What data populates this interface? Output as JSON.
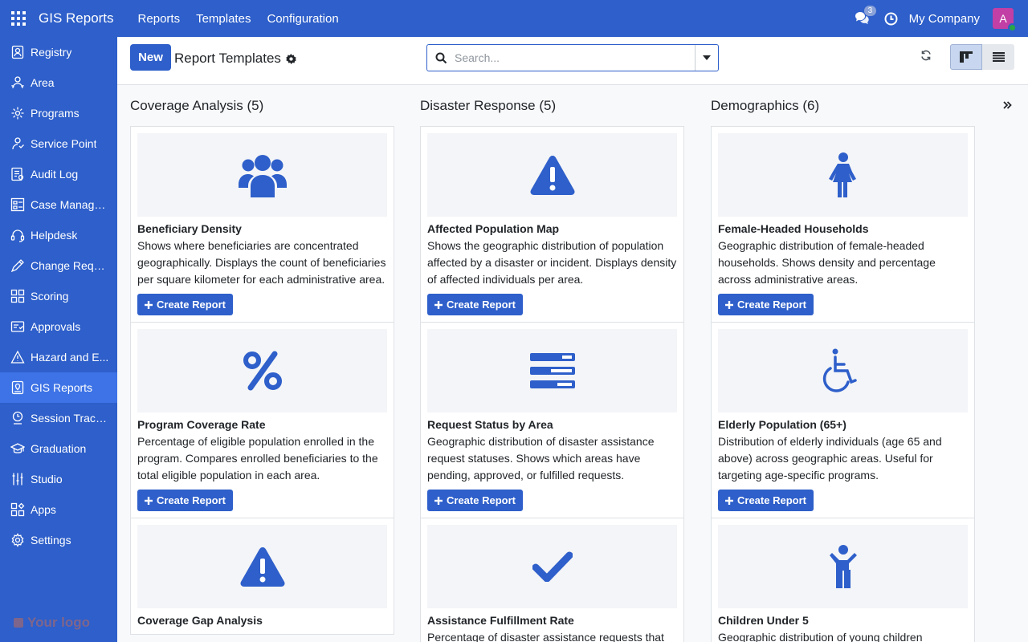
{
  "app": {
    "name": "GIS Reports",
    "menu": [
      "Reports",
      "Templates",
      "Configuration"
    ],
    "notifications": "3",
    "company": "My Company",
    "avatar_letter": "A"
  },
  "sidebar": {
    "items": [
      {
        "label": "Registry",
        "icon": "registry-icon"
      },
      {
        "label": "Area",
        "icon": "area-icon"
      },
      {
        "label": "Programs",
        "icon": "programs-icon"
      },
      {
        "label": "Service Point",
        "icon": "service-point-icon"
      },
      {
        "label": "Audit Log",
        "icon": "audit-log-icon"
      },
      {
        "label": "Case Manage...",
        "icon": "case-management-icon"
      },
      {
        "label": "Helpdesk",
        "icon": "helpdesk-icon"
      },
      {
        "label": "Change Requ...",
        "icon": "change-request-icon"
      },
      {
        "label": "Scoring",
        "icon": "scoring-icon"
      },
      {
        "label": "Approvals",
        "icon": "approvals-icon"
      },
      {
        "label": "Hazard and E...",
        "icon": "hazard-icon"
      },
      {
        "label": "GIS Reports",
        "icon": "gis-reports-icon",
        "active": true
      },
      {
        "label": "Session Tracki...",
        "icon": "session-tracking-icon"
      },
      {
        "label": "Graduation",
        "icon": "graduation-icon"
      },
      {
        "label": "Studio",
        "icon": "studio-icon"
      },
      {
        "label": "Apps",
        "icon": "apps-icon"
      },
      {
        "label": "Settings",
        "icon": "settings-icon"
      }
    ],
    "logo_text": "Your logo"
  },
  "control": {
    "new_label": "New",
    "breadcrumb": "Report Templates",
    "search_placeholder": "Search..."
  },
  "columns": [
    {
      "title": "Coverage Analysis (5)",
      "cards": [
        {
          "icon": "users-icon",
          "title": "Beneficiary Density",
          "desc": "Shows where beneficiaries are concentrated geographically. Displays the count of beneficiaries per square kilometer for each administrative area.",
          "button": "Create Report"
        },
        {
          "icon": "percent-icon",
          "title": "Program Coverage Rate",
          "desc": "Percentage of eligible population enrolled in the program. Compares enrolled beneficiaries to the total eligible population in each area.",
          "button": "Create Report"
        },
        {
          "icon": "warning-icon",
          "title": "Coverage Gap Analysis",
          "desc": "",
          "button": ""
        }
      ]
    },
    {
      "title": "Disaster Response (5)",
      "cards": [
        {
          "icon": "warning-icon",
          "title": "Affected Population Map",
          "desc": "Shows the geographic distribution of population affected by a disaster or incident. Displays density of affected individuals per area.",
          "button": "Create Report"
        },
        {
          "icon": "tasks-icon",
          "title": "Request Status by Area",
          "desc": "Geographic distribution of disaster assistance request statuses. Shows which areas have pending, approved, or fulfilled requests.",
          "button": "Create Report"
        },
        {
          "icon": "check-icon",
          "title": "Assistance Fulfillment Rate",
          "desc": "Percentage of disaster assistance requests that",
          "button": ""
        }
      ]
    },
    {
      "title": "Demographics (6)",
      "cards": [
        {
          "icon": "female-icon",
          "title": "Female-Headed Households",
          "desc": "Geographic distribution of female-headed households. Shows density and percentage across administrative areas.",
          "button": "Create Report"
        },
        {
          "icon": "wheelchair-icon",
          "title": "Elderly Population (65+)",
          "desc": "Distribution of elderly individuals (age 65 and above) across geographic areas. Useful for targeting age-specific programs.",
          "button": "Create Report"
        },
        {
          "icon": "child-icon",
          "title": "Children Under 5",
          "desc": "Geographic distribution of young children",
          "button": ""
        }
      ]
    }
  ]
}
